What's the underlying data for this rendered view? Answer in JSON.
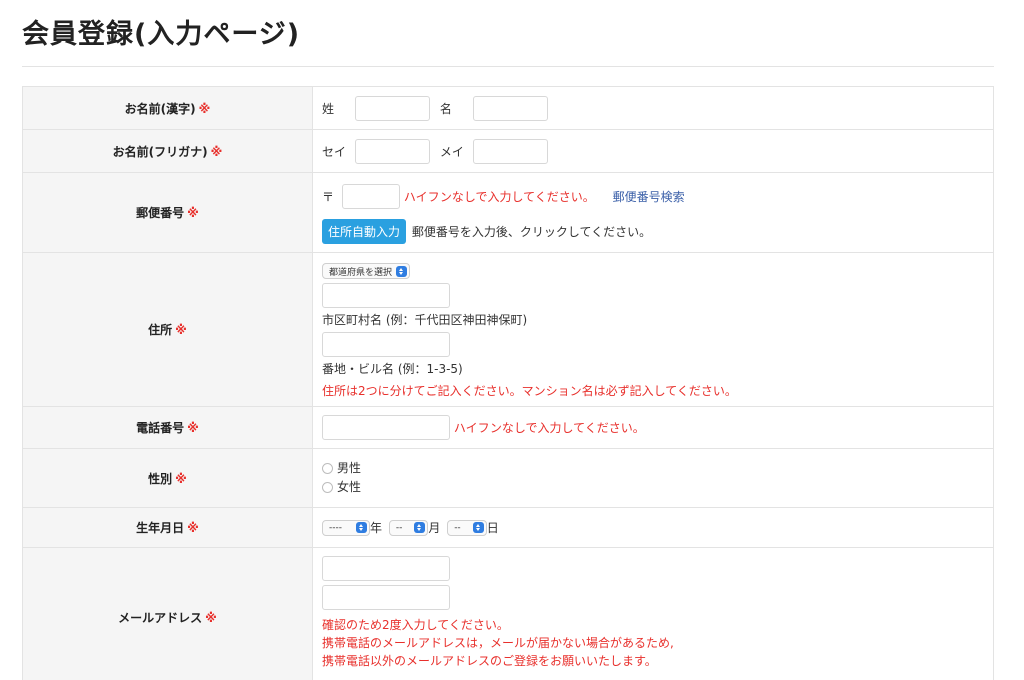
{
  "page": {
    "title": "会員登録(入力ページ)"
  },
  "required_mark": "※",
  "rows": {
    "name_kanji": {
      "label": "お名前(漢字)",
      "last_label": "姓",
      "first_label": "名",
      "last_value": "",
      "first_value": ""
    },
    "name_kana": {
      "label": "お名前(フリガナ)",
      "last_label": "セイ",
      "first_label": "メイ",
      "last_value": "",
      "first_value": ""
    },
    "postal": {
      "label": "郵便番号",
      "prefix": "〒",
      "value": "",
      "note": "ハイフンなしで入力してください。",
      "search_link": "郵便番号検索",
      "auto_button": "住所自動入力",
      "auto_note": "郵便番号を入力後、クリックしてください。"
    },
    "address": {
      "label": "住所",
      "pref_select": "都道府県を選択",
      "city_value": "",
      "city_hint": "市区町村名 (例：千代田区神田神保町)",
      "street_value": "",
      "street_hint": "番地・ビル名 (例：1-3-5)",
      "note": "住所は2つに分けてご記入ください。マンション名は必ず記入してください。"
    },
    "phone": {
      "label": "電話番号",
      "value": "",
      "note": "ハイフンなしで入力してください。"
    },
    "gender": {
      "label": "性別",
      "options": [
        "男性",
        "女性"
      ]
    },
    "birth": {
      "label": "生年月日",
      "year_select": "----",
      "year_unit": "年",
      "month_select": "--",
      "month_unit": "月",
      "day_select": "--",
      "day_unit": "日"
    },
    "email": {
      "label": "メールアドレス",
      "value": "",
      "confirm_value": "",
      "note1": "確認のため2度入力してください。",
      "note2": "携帯電話のメールアドレスは，メールが届かない場合があるため,",
      "note3": "携帯電話以外のメールアドレスのご登録をお願いいたします。"
    }
  },
  "colors": {
    "required": "#e8302c",
    "link": "#3a5fa8",
    "button": "#2aa0e0",
    "header_bg": "#f5f5f5"
  }
}
